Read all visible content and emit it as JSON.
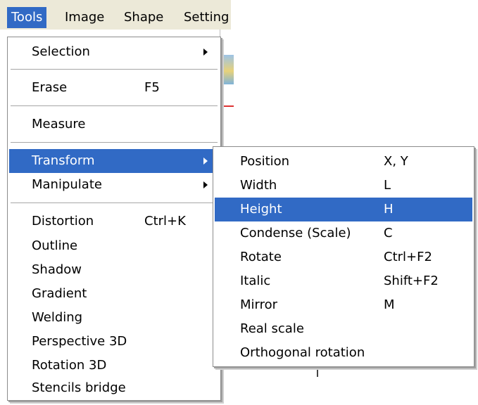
{
  "menubar": {
    "items": [
      {
        "label": "Tools",
        "active": true
      },
      {
        "label": "Image",
        "active": false
      },
      {
        "label": "Shape",
        "active": false
      },
      {
        "label": "Setting",
        "active": false
      }
    ]
  },
  "tools_menu": {
    "items": [
      {
        "label": "Selection",
        "shortcut": "",
        "submenu": true
      },
      {
        "label": "Erase",
        "shortcut": "F5",
        "submenu": false
      },
      {
        "label": "Measure",
        "shortcut": "",
        "submenu": false
      },
      {
        "label": "Transform",
        "shortcut": "",
        "submenu": true,
        "highlighted": true
      },
      {
        "label": "Manipulate",
        "shortcut": "",
        "submenu": true
      },
      {
        "label": "Distortion",
        "shortcut": "Ctrl+K",
        "submenu": false
      },
      {
        "label": "Outline",
        "shortcut": "",
        "submenu": false
      },
      {
        "label": "Shadow",
        "shortcut": "",
        "submenu": false
      },
      {
        "label": "Gradient",
        "shortcut": "",
        "submenu": false
      },
      {
        "label": "Welding",
        "shortcut": "",
        "submenu": false
      },
      {
        "label": "Perspective 3D",
        "shortcut": "",
        "submenu": false
      },
      {
        "label": "Rotation 3D",
        "shortcut": "",
        "submenu": false
      },
      {
        "label": "Stencils bridge",
        "shortcut": "",
        "submenu": false
      }
    ]
  },
  "transform_submenu": {
    "items": [
      {
        "label": "Position",
        "shortcut": "X, Y"
      },
      {
        "label": "Width",
        "shortcut": "L"
      },
      {
        "label": "Height",
        "shortcut": "H",
        "highlighted": true
      },
      {
        "label": "Condense (Scale)",
        "shortcut": "C"
      },
      {
        "label": "Rotate",
        "shortcut": "Ctrl+F2"
      },
      {
        "label": "Italic",
        "shortcut": "Shift+F2"
      },
      {
        "label": "Mirror",
        "shortcut": "M"
      },
      {
        "label": "Real scale",
        "shortcut": ""
      },
      {
        "label": "Orthogonal rotation",
        "shortcut": ""
      }
    ]
  },
  "colors": {
    "menu_highlight": "#316ac5",
    "menubar_bg": "#ece9d8"
  }
}
